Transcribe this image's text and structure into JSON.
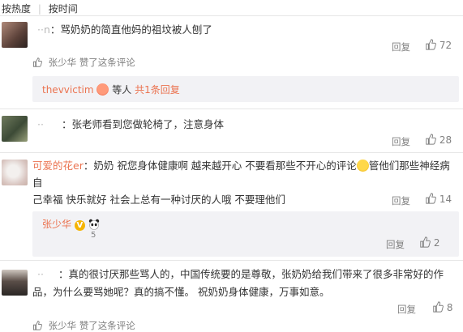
{
  "sort": {
    "hot": "按热度",
    "sep": "|",
    "time": "按时间"
  },
  "comments": [
    {
      "user": "··n",
      "text": "：骂奶奶的简直他妈的祖坟被人刨了",
      "reply_label": "回复",
      "likes": "72",
      "liked_by_user": "张少华",
      "liked_note": "赞了这条评论",
      "sub": {
        "user": "thevvictim",
        "etc": "等人",
        "more": "共1条回复"
      }
    },
    {
      "user": "··",
      "text": "：张老师看到您做轮椅了，注意身体",
      "reply_label": "回复",
      "likes": "28"
    },
    {
      "user": "可爱的花er",
      "text_part1": "：奶奶 祝您身体健康啊 越来越开心 不要看那些不开心的评论",
      "text_part2": "管他们那些神经病 自",
      "text_line2": "己幸福 快乐就好 社会上总有一种讨厌的人哦 不要理他们",
      "reply_label": "回复",
      "likes": "14",
      "sub": {
        "user": "张少华",
        "rest": "5",
        "reply_label": "回复",
        "likes": "2"
      }
    },
    {
      "user": "··",
      "text_line1": "：真的很讨厌那些骂人的，中国传统要的是尊敬，张奶奶给我们带来了很多非常好的作",
      "text_line2": "品，为什么要骂她呢？真的搞不懂。 祝奶奶身体健康，万事如意。",
      "reply_label": "回复",
      "likes": "8",
      "liked_by_user": "张少华",
      "liked_note": "赞了这条评论"
    }
  ],
  "colors": {
    "link": "#eb7350",
    "text": "#333333",
    "muted": "#808080",
    "reply_bg": "#f2f2f5"
  },
  "icons": [
    "thumb-up-icon",
    "thumb-small-icon",
    "smile-emoji-icon",
    "verified-v-icon",
    "panda-icon"
  ]
}
